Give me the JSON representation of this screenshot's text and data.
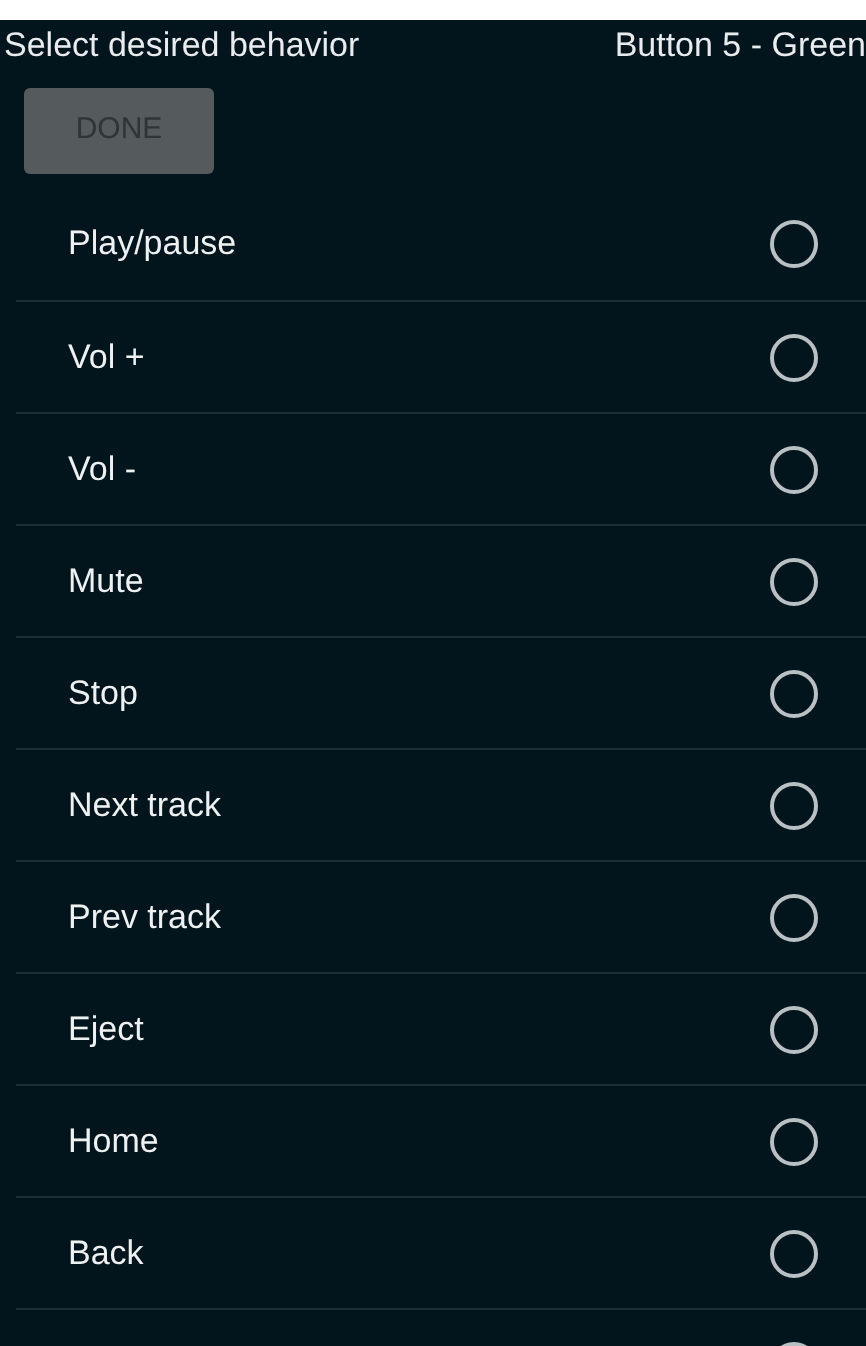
{
  "header": {
    "title": "Select desired behavior",
    "button_name": "Button 5 - Green"
  },
  "done_button": {
    "label": "DONE",
    "disabled": true
  },
  "options": [
    {
      "label": "Play/pause",
      "selected": false
    },
    {
      "label": "Vol +",
      "selected": false
    },
    {
      "label": "Vol -",
      "selected": false
    },
    {
      "label": "Mute",
      "selected": false
    },
    {
      "label": "Stop",
      "selected": false
    },
    {
      "label": "Next track",
      "selected": false
    },
    {
      "label": "Prev track",
      "selected": false
    },
    {
      "label": "Eject",
      "selected": false
    },
    {
      "label": "Home",
      "selected": false
    },
    {
      "label": "Back",
      "selected": false
    },
    {
      "selected": false
    }
  ]
}
